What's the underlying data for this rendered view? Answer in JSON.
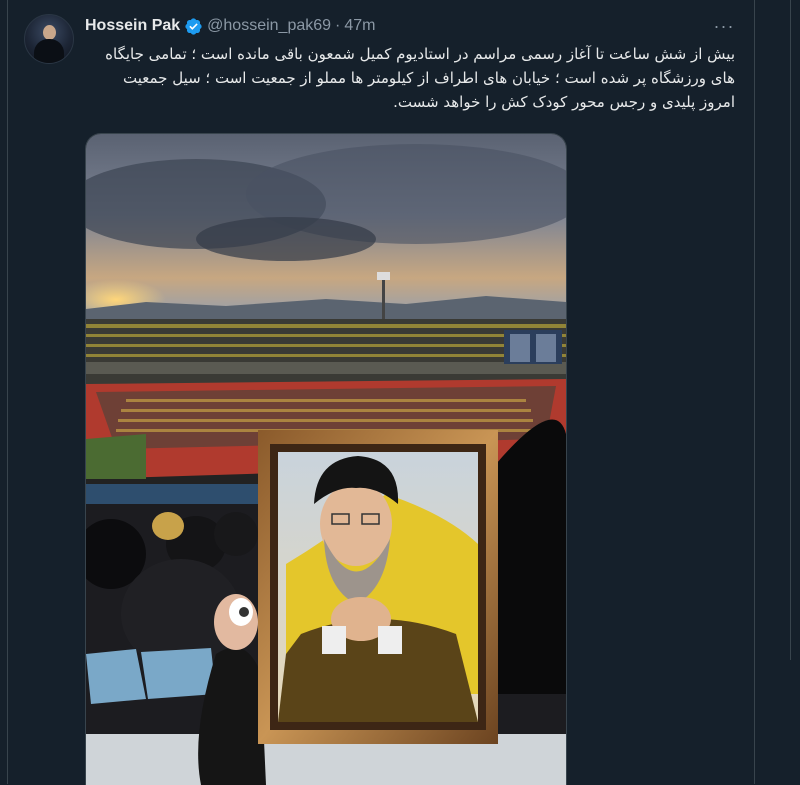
{
  "tweet": {
    "author_name": "Hossein Pak",
    "handle": "@hossein_pak69",
    "separator": "·",
    "time": "47m",
    "more_label": "···",
    "text": "بیش از شش ساعت تا آغاز رسمی مراسم در استادیوم کمیل شمعون باقی مانده است ؛ تمامی جایگاه های ورزشگاه پر شده است ؛ خیابان های اطراف از کیلومتر ها مملو از جمعیت است ؛ سیل جمعیت امروز پلیدی و رجس محور کودک کش را خواهد شست."
  },
  "colors": {
    "background": "#15202b",
    "verified": "#1d9bf0",
    "secondary_text": "#8b98a5"
  },
  "icons": {
    "verified": "verified-badge-icon",
    "more": "more-options-icon"
  }
}
